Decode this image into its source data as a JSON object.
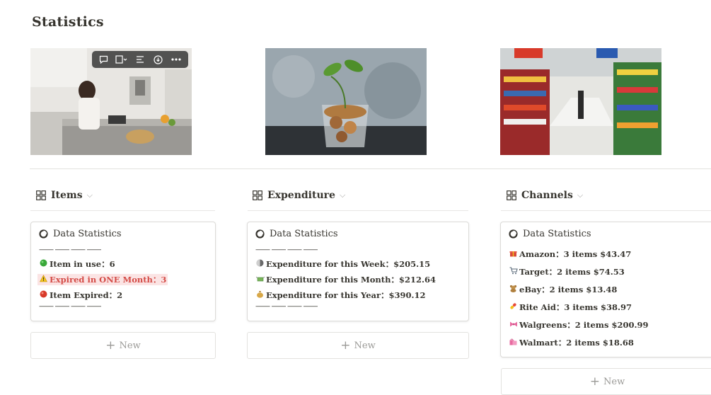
{
  "page": {
    "title": "Statistics"
  },
  "gallery": [
    {
      "name": "kitchen-image"
    },
    {
      "name": "coins-plant-image"
    },
    {
      "name": "supermarket-image"
    }
  ],
  "image_toolbar": {
    "icons": [
      "comment-icon",
      "layout-icon",
      "align-icon",
      "download-icon",
      "more-icon"
    ]
  },
  "views": [
    {
      "title": "Items",
      "card_title": "Data Statistics",
      "separator": "—— —— —— ——",
      "rows": [
        {
          "icon": "green-circle-icon",
          "label": "Item in use：6"
        },
        {
          "icon": "warning-icon",
          "label": "Expired in ONE Month：3",
          "highlight": "#fbe4e4"
        },
        {
          "icon": "red-circle-icon",
          "label": "Item Expired：2"
        }
      ],
      "new_label": "New"
    },
    {
      "title": "Expenditure",
      "card_title": "Data Statistics",
      "separator": "—— —— —— ——",
      "rows": [
        {
          "icon": "half-moon-icon",
          "label": "Expenditure for this Week：$205.15"
        },
        {
          "icon": "money-wings-icon",
          "label": "Expenditure for this Month：$212.64"
        },
        {
          "icon": "money-bag-icon",
          "label": "Expenditure for this Year：$390.12"
        }
      ],
      "new_label": "New"
    },
    {
      "title": "Channels",
      "card_title": "Data Statistics",
      "rows": [
        {
          "icon": "gift-icon",
          "label": "Amazon：3 items $43.47"
        },
        {
          "icon": "cart-icon",
          "label": "Target：2 items $74.53"
        },
        {
          "icon": "teddy-bear-icon",
          "label": "eBay：2 items $13.48"
        },
        {
          "icon": "pill-icon",
          "label": "Rite Aid：3 items $38.97"
        },
        {
          "icon": "ribbon-icon",
          "label": "Walgreens：2 items $200.99"
        },
        {
          "icon": "shopping-bags-icon",
          "label": "Walmart：2 items $18.68"
        }
      ],
      "new_label": "New"
    }
  ]
}
